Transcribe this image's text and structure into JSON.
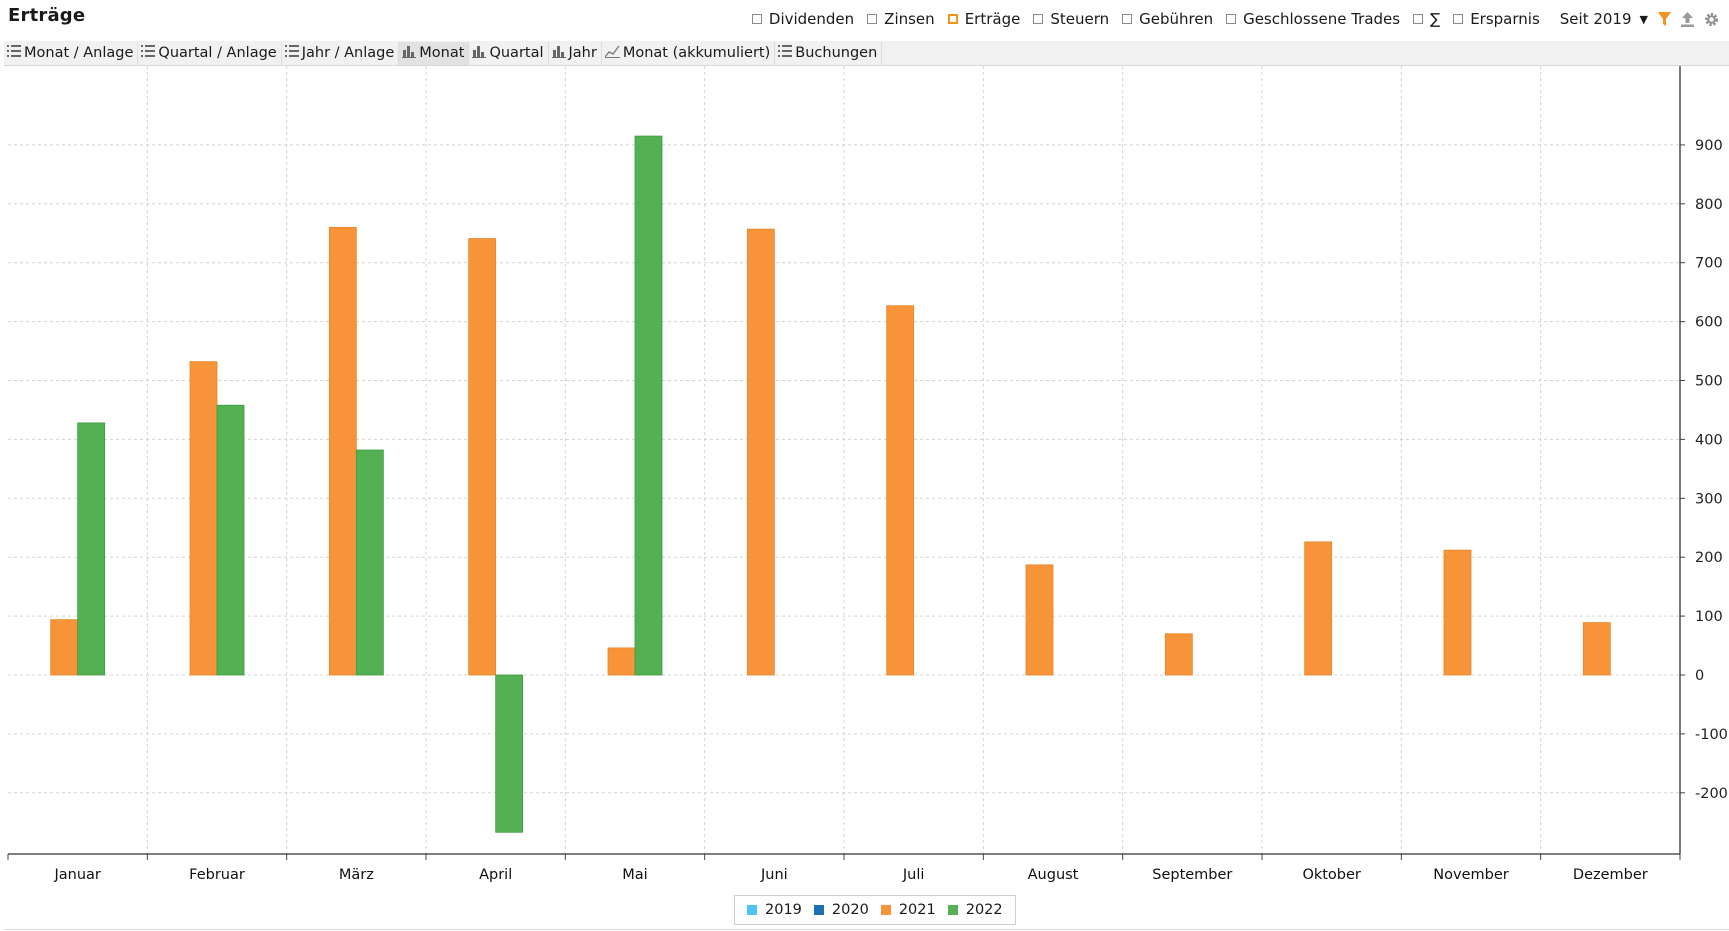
{
  "header": {
    "title": "Erträge",
    "filters": [
      {
        "label": "Dividenden",
        "checked": false
      },
      {
        "label": "Zinsen",
        "checked": false
      },
      {
        "label": "Erträge",
        "checked": true
      },
      {
        "label": "Steuern",
        "checked": false
      },
      {
        "label": "Gebühren",
        "checked": false
      },
      {
        "label": "Geschlossene Trades",
        "checked": false
      },
      {
        "label": "∑",
        "checked": false
      },
      {
        "label": "Ersparnis",
        "checked": false
      }
    ],
    "period": "Seit 2019",
    "icons": [
      "chevron-down-icon",
      "filter-icon",
      "export-icon",
      "gear-icon"
    ],
    "accent_color": "#f2921f"
  },
  "tabs": [
    {
      "label": "Monat / Anlage",
      "icon": "list-icon"
    },
    {
      "label": "Quartal / Anlage",
      "icon": "list-icon"
    },
    {
      "label": "Jahr / Anlage",
      "icon": "list-icon"
    },
    {
      "label": "Monat",
      "icon": "bar-chart-icon",
      "active": true
    },
    {
      "label": "Quartal",
      "icon": "bar-chart-icon"
    },
    {
      "label": "Jahr",
      "icon": "bar-chart-icon"
    },
    {
      "label": "Monat (akkumuliert)",
      "icon": "line-chart-icon"
    },
    {
      "label": "Buchungen",
      "icon": "list-icon"
    }
  ],
  "chart_data": {
    "type": "bar",
    "categories": [
      "Januar",
      "Februar",
      "März",
      "April",
      "Mai",
      "Juni",
      "Juli",
      "August",
      "September",
      "Oktober",
      "November",
      "Dezember"
    ],
    "series": [
      {
        "name": "2019",
        "color": "#4fc3f7",
        "values": [
          null,
          null,
          null,
          null,
          null,
          null,
          null,
          null,
          null,
          null,
          null,
          null
        ]
      },
      {
        "name": "2020",
        "color": "#1f6fb5",
        "values": [
          null,
          null,
          null,
          null,
          null,
          null,
          null,
          null,
          null,
          null,
          null,
          null
        ]
      },
      {
        "name": "2021",
        "color": "#f7943a",
        "values": [
          94,
          532,
          760,
          741,
          46,
          757,
          627,
          187,
          70,
          226,
          212,
          89
        ]
      },
      {
        "name": "2022",
        "color": "#53b153",
        "values": [
          428,
          458,
          382,
          -267,
          915,
          null,
          null,
          null,
          null,
          null,
          null,
          null
        ]
      }
    ],
    "yticks": [
      "900",
      "800",
      "700",
      "600",
      "500",
      "400",
      "300",
      "200",
      "100",
      "0",
      "-100",
      "-200"
    ],
    "ylim": [
      -275,
      935
    ],
    "grid": true,
    "legend_position": "bottom"
  }
}
